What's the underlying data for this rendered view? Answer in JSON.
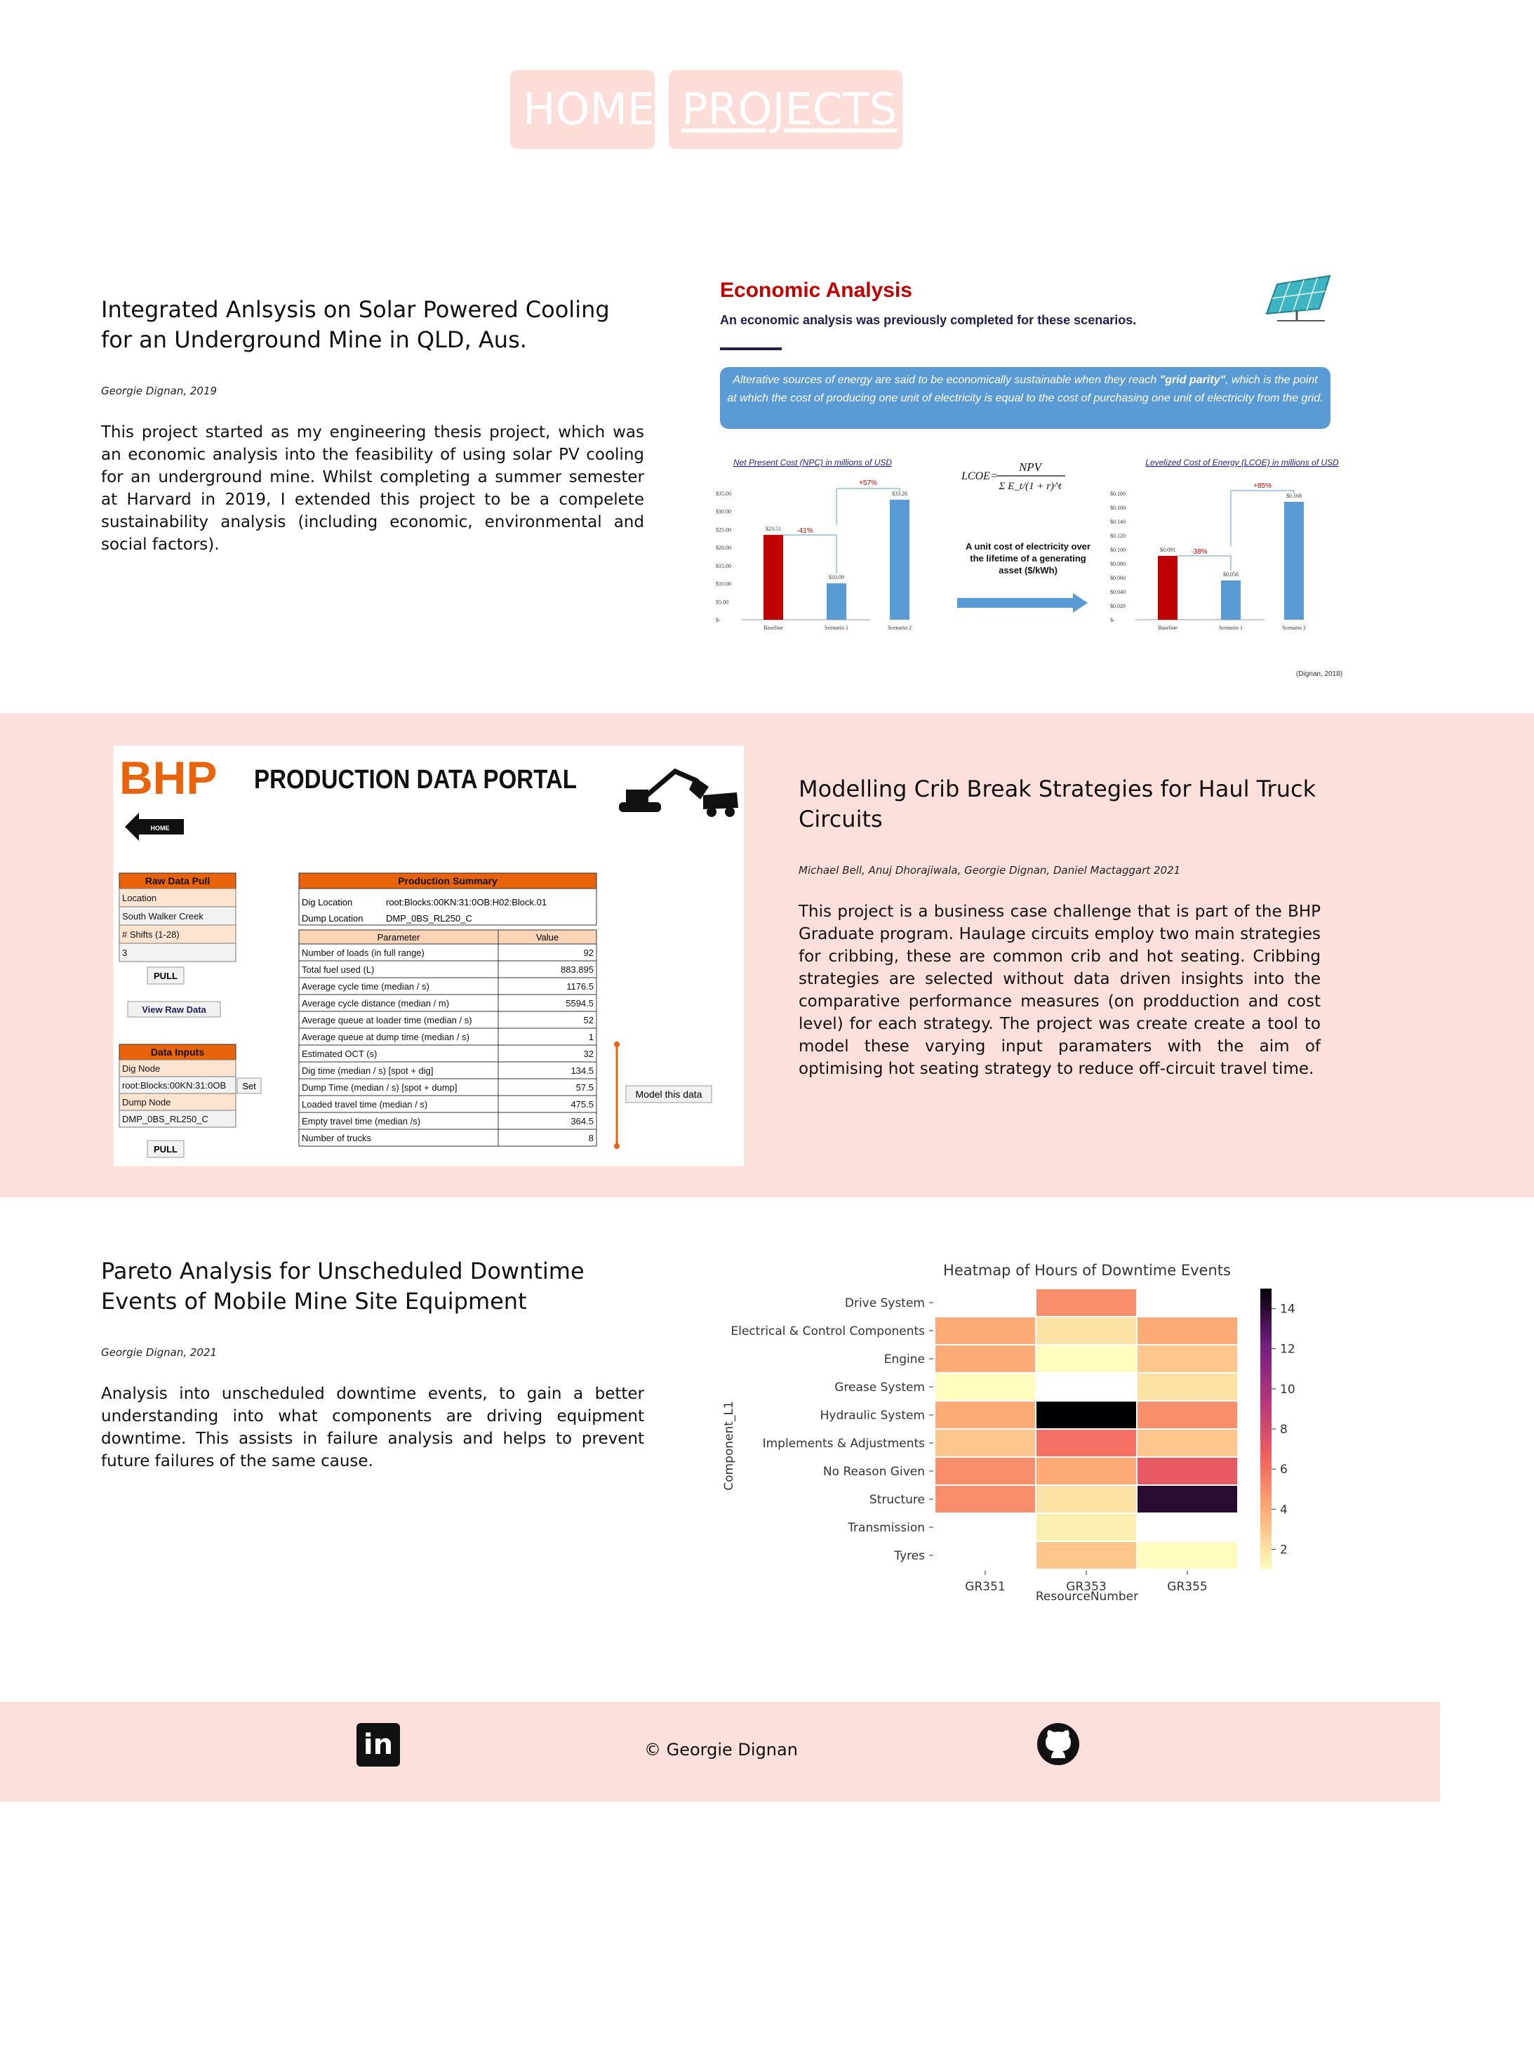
{
  "nav": {
    "home": "HOME",
    "projects": "PROJECTS"
  },
  "projects": [
    {
      "title": "Integrated Anlsysis on Solar Powered Cooling for an Underground Mine in QLD, Aus.",
      "author": "Georgie Dignan, 2019",
      "description": "This project started as my engineering thesis project, which was an economic analysis into the feasibility of using solar PV cooling for an underground mine. Whilst completing a summer semester at Harvard in 2019, I extended this project to be a compelete sustainability analysis (including economic, environmental and social factors)."
    },
    {
      "title": "Modelling Crib Break Strategies for Haul Truck Circuits",
      "author": "Michael Bell, Anuj Dhorajiwala, Georgie Dignan, Daniel Mactaggart 2021",
      "description": "This project is a business case challenge that is part of the BHP Graduate program. Haulage circuits employ two main strategies for cribbing, these are common crib and hot seating. Cribbing strategies are selected without data driven insights into the comparative performance measures (on prodduction and cost level) for each strategy. The project was create create a tool to model these varying input paramaters with the aim of optimising hot seating strategy to reduce off-circuit travel time."
    },
    {
      "title": "Pareto Analysis for Unscheduled Downtime Events of Mobile Mine Site Equipment",
      "author": "Georgie Dignan, 2021",
      "description": "Analysis into unscheduled downtime events, to gain a better understanding into what components are driving equipment downtime. This assists in failure analysis and helps to prevent future failures of the same cause."
    }
  ],
  "econ": {
    "heading": "Economic Analysis",
    "subheading": "An economic analysis was previously completed for these scenarios.",
    "callout_pre": "Alterative sources of energy are said to be economically sustainable when they reach ",
    "callout_bold": "\"grid parity\"",
    "callout_post": ", which is the point at which the cost of producing one unit of electricity is equal to the cost of purchasing one unit of electricity from the grid.",
    "npc_title": "Net Present Cost (NPC) in millions of USD",
    "lcoe_title": "Levelized Cost of Energy (LCOE) in millions of USD",
    "formula_lhs": "LCOE=",
    "formula_num": "NPV",
    "formula_den": "Σ E_t/(1 + r)^t",
    "formula_note": "A unit cost of electricity over the lifetime of a generating asset ($/kWh)",
    "credit": "(Dignan, 2018)",
    "npc": {
      "categories": [
        "Baseline",
        "Scenario 1",
        "Scenario 2"
      ],
      "values": [
        23.51,
        10.09,
        33.26
      ],
      "labels": [
        "$23.51",
        "$10.09",
        "$33.26"
      ],
      "ticks": [
        "$35.00",
        "$30.00",
        "$25.00",
        "$20.00",
        "$15.00",
        "$10.00",
        "$5.00",
        "$-"
      ],
      "deltas": [
        "-41%",
        "+57%"
      ]
    },
    "lcoe": {
      "categories": [
        "Baseline",
        "Scenario 1",
        "Scenario 2"
      ],
      "values": [
        0.091,
        0.056,
        0.168
      ],
      "labels": [
        "$0.091",
        "$0.056",
        "$0.168"
      ],
      "ticks": [
        "$0.180",
        "$0.160",
        "$0.140",
        "$0.120",
        "$0.100",
        "$0.080",
        "$0.060",
        "$0.040",
        "$0.020",
        "$-"
      ],
      "deltas": [
        "-38%",
        "+85%"
      ]
    },
    "colors": {
      "accent": "#c00000",
      "bar_blue": "#5b9bd5",
      "callout": "#5b9bd5"
    }
  },
  "bhp": {
    "logo": "BHP",
    "title": "PRODUCTION DATA PORTAL",
    "home": "HOME",
    "raw_header": "Raw Data Pull",
    "raw_rows": [
      "Location",
      "South Walker Creek",
      "# Shifts (1-28)",
      "3"
    ],
    "pull": "PULL",
    "view_raw": "View Raw Data",
    "inputs_header": "Data Inputs",
    "inputs_rows": [
      "Dig Node",
      "root:Blocks:00KN:31:0OB",
      "Dump Node",
      "DMP_0BS_RL250_C"
    ],
    "set": "Set",
    "summary_header": "Production Summary",
    "dig_location_label": "Dig Location",
    "dig_location_value": "root:Blocks:00KN:31:0OB:H02:Block.01",
    "dump_location_label": "Dump Location",
    "dump_location_value": "DMP_0BS_RL250_C",
    "param_col": "Parameter",
    "value_col": "Value",
    "rows": [
      [
        "Number of loads (in full range)",
        "92"
      ],
      [
        "Total fuel used (L)",
        "883.895"
      ],
      [
        "Average cycle time (median / s)",
        "1176.5"
      ],
      [
        "Average cycle distance (median / m)",
        "5594.5"
      ],
      [
        "Average queue at loader time (median / s)",
        "52"
      ],
      [
        "Average queue at dump time (median / s)",
        "1"
      ],
      [
        "Estimated OCT (s)",
        "32"
      ],
      [
        "Dig time (median / s) [spot + dig]",
        "134.5"
      ],
      [
        "Dump Time (median / s) [spot + dump]",
        "57.5"
      ],
      [
        "Loaded travel time (median / s)",
        "475.5"
      ],
      [
        "Empty travel time (median /s)",
        "364.5"
      ],
      [
        "Number of trucks",
        "8"
      ]
    ],
    "model": "Model this data"
  },
  "chart_data": {
    "type": "heatmap",
    "title": "Heatmap of Hours of Downtime Events",
    "xlabel": "ResourceNumber",
    "ylabel": "Component_L1",
    "x": [
      "GR351",
      "GR353",
      "GR355"
    ],
    "y": [
      "Drive System",
      "Electrical & Control Components",
      "Engine",
      "Grease System",
      "Hydraulic System",
      "Implements & Adjustments",
      "No Reason Given",
      "Structure",
      "Transmission",
      "Tyres"
    ],
    "values": [
      [
        null,
        5,
        null
      ],
      [
        4,
        2,
        4
      ],
      [
        4,
        1,
        3
      ],
      [
        1,
        null,
        2
      ],
      [
        4,
        15,
        5
      ],
      [
        3,
        6,
        3
      ],
      [
        5,
        4,
        7
      ],
      [
        5,
        2,
        14
      ],
      [
        null,
        1.5,
        null
      ],
      [
        null,
        3,
        1
      ]
    ],
    "colorbar_ticks": [
      "14",
      "12",
      "10",
      "8",
      "6",
      "4",
      "2"
    ],
    "vmin": 1,
    "vmax": 15
  },
  "footer": {
    "copyright": "© Georgie Dignan"
  }
}
